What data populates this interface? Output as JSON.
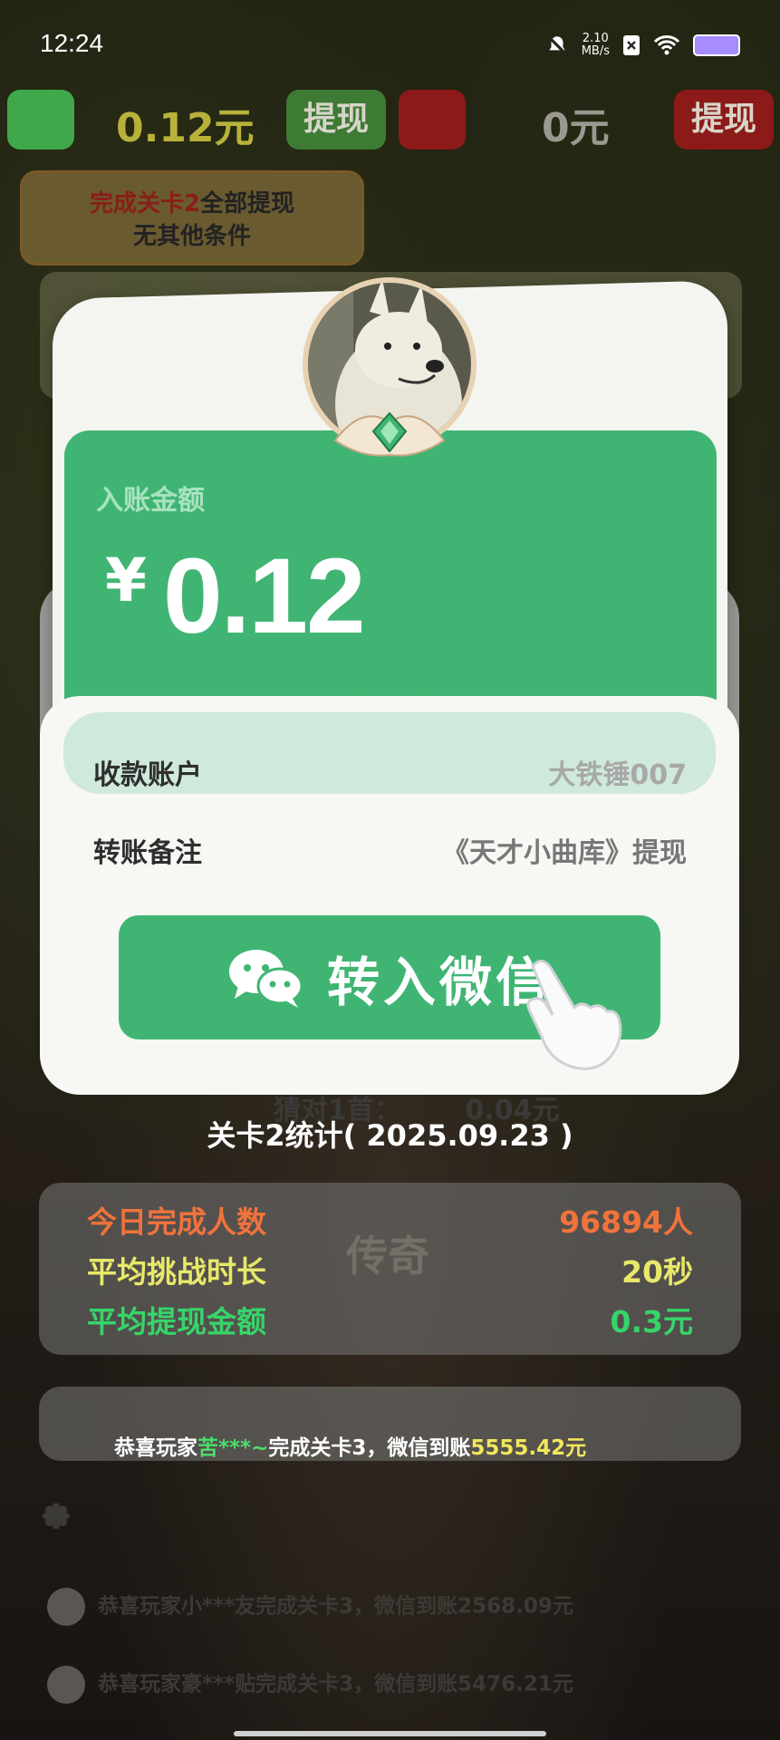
{
  "status": {
    "time": "12:24",
    "speed_value": "2.10",
    "speed_unit": "MB/s"
  },
  "top": {
    "wechat_balance": "0.12元",
    "withdraw_label": "提现",
    "redpacket_balance": "0元",
    "withdraw_label_2": "提现"
  },
  "condition": {
    "prefix": "完成关卡2",
    "line1_rest": "全部提现",
    "line2": "无其他条件"
  },
  "modal": {
    "amount_label": "入账金额",
    "currency": "¥",
    "amount": "0.12",
    "account_label": "收款账户",
    "account_value": "大铁锤007",
    "remark_label": "转账备注",
    "remark_value": "《天才小曲库》提现",
    "button_label": "转入微信"
  },
  "background_text": {
    "guess_line": "猜对1首：",
    "guess_amount": "0.04元",
    "ghost_word": "传奇"
  },
  "stats": {
    "title": "关卡2统计( 2025.09.23 )",
    "rows": [
      {
        "label": "今日完成人数",
        "value": "96894人"
      },
      {
        "label": "平均挑战时长",
        "value": "20秒"
      },
      {
        "label": "平均提现金额",
        "value": "0.3元"
      }
    ]
  },
  "notice": {
    "prefix": "恭喜玩家",
    "name": "苦***~",
    "middle": "完成关卡3，微信到账",
    "amount": "5555.42元"
  },
  "feed": [
    {
      "text": "恭喜玩家小***友完成关卡3，微信到账2568.09元"
    },
    {
      "text": "恭喜玩家豪***贴完成关卡3，微信到账5476.21元"
    }
  ],
  "colors": {
    "wechat_green": "#40b573",
    "accent_orange": "#f0733c",
    "accent_yellow": "#e8e86a",
    "accent_green": "#37d46a"
  }
}
